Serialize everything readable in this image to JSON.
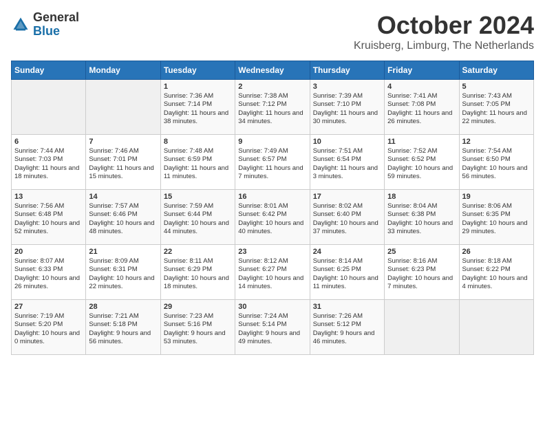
{
  "header": {
    "logo_general": "General",
    "logo_blue": "Blue",
    "month": "October 2024",
    "location": "Kruisberg, Limburg, The Netherlands"
  },
  "days_of_week": [
    "Sunday",
    "Monday",
    "Tuesday",
    "Wednesday",
    "Thursday",
    "Friday",
    "Saturday"
  ],
  "weeks": [
    [
      {
        "day": "",
        "info": ""
      },
      {
        "day": "",
        "info": ""
      },
      {
        "day": "1",
        "info": "Sunrise: 7:36 AM\nSunset: 7:14 PM\nDaylight: 11 hours and 38 minutes."
      },
      {
        "day": "2",
        "info": "Sunrise: 7:38 AM\nSunset: 7:12 PM\nDaylight: 11 hours and 34 minutes."
      },
      {
        "day": "3",
        "info": "Sunrise: 7:39 AM\nSunset: 7:10 PM\nDaylight: 11 hours and 30 minutes."
      },
      {
        "day": "4",
        "info": "Sunrise: 7:41 AM\nSunset: 7:08 PM\nDaylight: 11 hours and 26 minutes."
      },
      {
        "day": "5",
        "info": "Sunrise: 7:43 AM\nSunset: 7:05 PM\nDaylight: 11 hours and 22 minutes."
      }
    ],
    [
      {
        "day": "6",
        "info": "Sunrise: 7:44 AM\nSunset: 7:03 PM\nDaylight: 11 hours and 18 minutes."
      },
      {
        "day": "7",
        "info": "Sunrise: 7:46 AM\nSunset: 7:01 PM\nDaylight: 11 hours and 15 minutes."
      },
      {
        "day": "8",
        "info": "Sunrise: 7:48 AM\nSunset: 6:59 PM\nDaylight: 11 hours and 11 minutes."
      },
      {
        "day": "9",
        "info": "Sunrise: 7:49 AM\nSunset: 6:57 PM\nDaylight: 11 hours and 7 minutes."
      },
      {
        "day": "10",
        "info": "Sunrise: 7:51 AM\nSunset: 6:54 PM\nDaylight: 11 hours and 3 minutes."
      },
      {
        "day": "11",
        "info": "Sunrise: 7:52 AM\nSunset: 6:52 PM\nDaylight: 10 hours and 59 minutes."
      },
      {
        "day": "12",
        "info": "Sunrise: 7:54 AM\nSunset: 6:50 PM\nDaylight: 10 hours and 56 minutes."
      }
    ],
    [
      {
        "day": "13",
        "info": "Sunrise: 7:56 AM\nSunset: 6:48 PM\nDaylight: 10 hours and 52 minutes."
      },
      {
        "day": "14",
        "info": "Sunrise: 7:57 AM\nSunset: 6:46 PM\nDaylight: 10 hours and 48 minutes."
      },
      {
        "day": "15",
        "info": "Sunrise: 7:59 AM\nSunset: 6:44 PM\nDaylight: 10 hours and 44 minutes."
      },
      {
        "day": "16",
        "info": "Sunrise: 8:01 AM\nSunset: 6:42 PM\nDaylight: 10 hours and 40 minutes."
      },
      {
        "day": "17",
        "info": "Sunrise: 8:02 AM\nSunset: 6:40 PM\nDaylight: 10 hours and 37 minutes."
      },
      {
        "day": "18",
        "info": "Sunrise: 8:04 AM\nSunset: 6:38 PM\nDaylight: 10 hours and 33 minutes."
      },
      {
        "day": "19",
        "info": "Sunrise: 8:06 AM\nSunset: 6:35 PM\nDaylight: 10 hours and 29 minutes."
      }
    ],
    [
      {
        "day": "20",
        "info": "Sunrise: 8:07 AM\nSunset: 6:33 PM\nDaylight: 10 hours and 26 minutes."
      },
      {
        "day": "21",
        "info": "Sunrise: 8:09 AM\nSunset: 6:31 PM\nDaylight: 10 hours and 22 minutes."
      },
      {
        "day": "22",
        "info": "Sunrise: 8:11 AM\nSunset: 6:29 PM\nDaylight: 10 hours and 18 minutes."
      },
      {
        "day": "23",
        "info": "Sunrise: 8:12 AM\nSunset: 6:27 PM\nDaylight: 10 hours and 14 minutes."
      },
      {
        "day": "24",
        "info": "Sunrise: 8:14 AM\nSunset: 6:25 PM\nDaylight: 10 hours and 11 minutes."
      },
      {
        "day": "25",
        "info": "Sunrise: 8:16 AM\nSunset: 6:23 PM\nDaylight: 10 hours and 7 minutes."
      },
      {
        "day": "26",
        "info": "Sunrise: 8:18 AM\nSunset: 6:22 PM\nDaylight: 10 hours and 4 minutes."
      }
    ],
    [
      {
        "day": "27",
        "info": "Sunrise: 7:19 AM\nSunset: 5:20 PM\nDaylight: 10 hours and 0 minutes."
      },
      {
        "day": "28",
        "info": "Sunrise: 7:21 AM\nSunset: 5:18 PM\nDaylight: 9 hours and 56 minutes."
      },
      {
        "day": "29",
        "info": "Sunrise: 7:23 AM\nSunset: 5:16 PM\nDaylight: 9 hours and 53 minutes."
      },
      {
        "day": "30",
        "info": "Sunrise: 7:24 AM\nSunset: 5:14 PM\nDaylight: 9 hours and 49 minutes."
      },
      {
        "day": "31",
        "info": "Sunrise: 7:26 AM\nSunset: 5:12 PM\nDaylight: 9 hours and 46 minutes."
      },
      {
        "day": "",
        "info": ""
      },
      {
        "day": "",
        "info": ""
      }
    ]
  ]
}
